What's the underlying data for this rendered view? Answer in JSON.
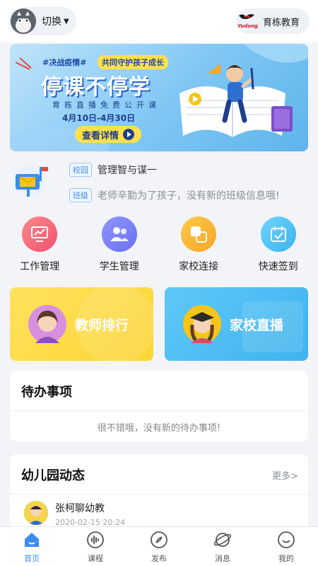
{
  "header": {
    "switch_label": "切换",
    "brand_name": "育栋教育",
    "brand_logo_text": "Yudong"
  },
  "banner": {
    "tag_left": "#决战疫情#",
    "tag_right": "共同守护孩子成长",
    "title": "停课不停学",
    "subtitle": "育栋直播免费公开课",
    "date_range": "4月10日-4月30日",
    "cta_label": "查看详情"
  },
  "notices": [
    {
      "tag": "校园",
      "text": "管理智与谋一"
    },
    {
      "tag": "班级",
      "text": "老师辛勤为了孩子，没有新的班级信息哦!"
    }
  ],
  "shortcuts": [
    {
      "label": "工作管理",
      "icon": "chart-monitor-icon",
      "color": "#f0506e"
    },
    {
      "label": "学生管理",
      "icon": "users-icon",
      "color": "#6a70f0"
    },
    {
      "label": "家校连接",
      "icon": "link-squares-icon",
      "color": "#f5a623"
    },
    {
      "label": "快速签到",
      "icon": "calendar-check-icon",
      "color": "#3bb4ee"
    }
  ],
  "feature_cards": [
    {
      "label": "教师排行",
      "color": "#fbd534"
    },
    {
      "label": "家校直播",
      "color": "#3fb3ee"
    }
  ],
  "todo": {
    "title": "待办事项",
    "empty_text": "很不错哦，没有新的待办事项!"
  },
  "news": {
    "title": "幼儿园动态",
    "more_label": "更多>",
    "items": [
      {
        "author": "张柯聊幼教",
        "time": "2020-02-15 20:24"
      }
    ]
  },
  "tabbar": {
    "active": "首页",
    "items": [
      {
        "label": "首页",
        "icon": "home-icon"
      },
      {
        "label": "课程",
        "icon": "soundwave-icon"
      },
      {
        "label": "发布",
        "icon": "compass-icon"
      },
      {
        "label": "消息",
        "icon": "planet-icon"
      },
      {
        "label": "我的",
        "icon": "smile-icon"
      }
    ]
  },
  "colors": {
    "accent": "#3d8cf0",
    "background": "#f2f4f7"
  }
}
